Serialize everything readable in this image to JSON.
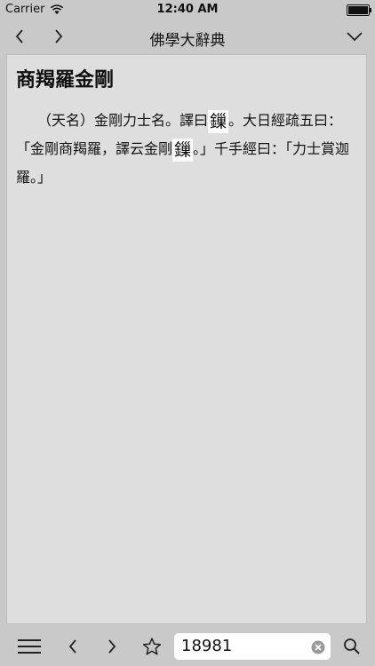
{
  "status": {
    "carrier": "Carrier",
    "time": "12:40 AM"
  },
  "nav": {
    "title": "佛學大辭典"
  },
  "entry": {
    "title": "商羯羅金剛",
    "p1": "（天名）金剛力士名。譯曰",
    "g1": "鏁",
    "p2": "。大日經疏五曰：「金剛商羯羅，譯云金剛",
    "g2": "鏁",
    "p3": "。」千手經曰：「力士賞迦羅。」"
  },
  "search": {
    "value": "18981"
  }
}
